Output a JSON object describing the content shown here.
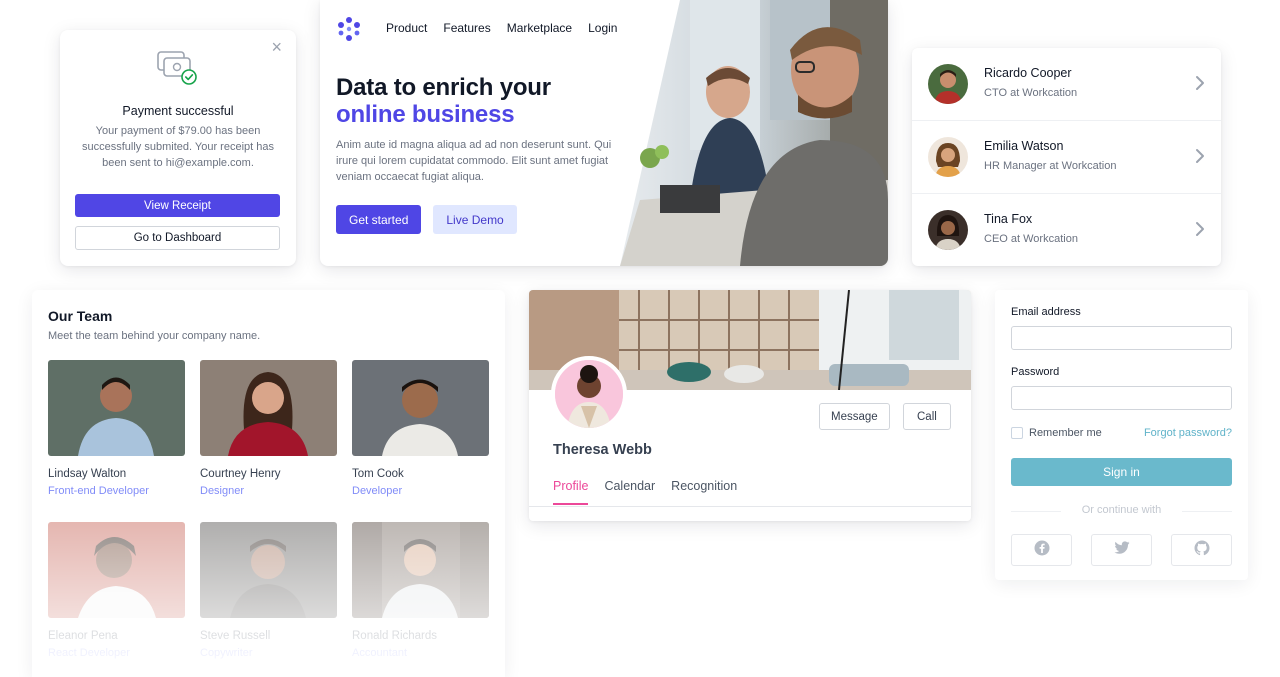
{
  "payment_modal": {
    "title": "Payment successful",
    "message": "Your payment of $79.00 has been successfully submited. Your receipt has been sent to hi@example.com.",
    "primary_button": "View Receipt",
    "secondary_button": "Go to Dashboard",
    "close_icon": "×"
  },
  "hero": {
    "nav": [
      "Product",
      "Features",
      "Marketplace",
      "Login"
    ],
    "headline_line1": "Data to enrich your",
    "headline_line2": "online business",
    "lead": "Anim aute id magna aliqua ad ad non deserunt sunt. Qui irure qui lorem cupidatat commodo. Elit sunt amet fugiat veniam occaecat fugiat aliqua.",
    "primary_cta": "Get started",
    "secondary_cta": "Live Demo",
    "accent_color": "#4f46e5"
  },
  "people": [
    {
      "name": "Ricardo Cooper",
      "role": "CTO at Workcation"
    },
    {
      "name": "Emilia Watson",
      "role": "HR Manager at Workcation"
    },
    {
      "name": "Tina Fox",
      "role": "CEO at Workcation"
    }
  ],
  "team": {
    "title": "Our Team",
    "subtitle": "Meet the team behind your company name.",
    "members": [
      {
        "name": "Lindsay Walton",
        "role": "Front-end Developer"
      },
      {
        "name": "Courtney Henry",
        "role": "Designer"
      },
      {
        "name": "Tom Cook",
        "role": "Developer"
      },
      {
        "name": "Eleanor Pena",
        "role": "React Developer"
      },
      {
        "name": "Steve Russell",
        "role": "Copywriter"
      },
      {
        "name": "Ronald Richards",
        "role": "Accountant"
      }
    ]
  },
  "profile": {
    "name": "Theresa Webb",
    "message_button": "Message",
    "call_button": "Call",
    "tabs": [
      "Profile",
      "Calendar",
      "Recognition"
    ],
    "active_tab": "Profile",
    "accent_color": "#ec4899"
  },
  "signin": {
    "email_label": "Email address",
    "password_label": "Password",
    "remember_label": "Remember me",
    "forgot_link": "Forgot password?",
    "submit_button": "Sign in",
    "divider_text": "Or continue with",
    "social": [
      "facebook-icon",
      "twitter-icon",
      "github-icon"
    ],
    "accent_color": "#6ab9cc"
  }
}
